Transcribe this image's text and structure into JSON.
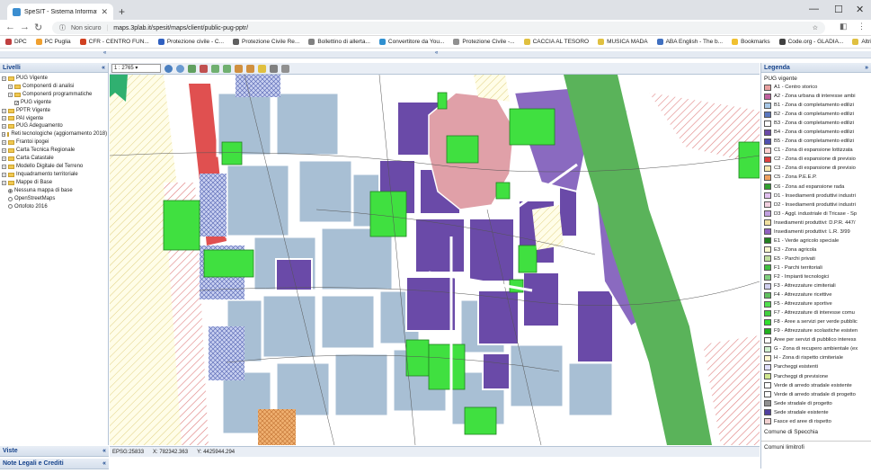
{
  "browser": {
    "tab_title": "SpeSIT - Sistema Informativo Terr",
    "new_tab": "+",
    "not_secure": "Non sicuro",
    "url": "maps.3plab.it/spesit/maps/client/public-pug-pptr/",
    "bookmarks": [
      "DPC",
      "PC Puglia",
      "CFR - CENTRO FUN...",
      "Protezione civile - C...",
      "Protezione Civile Re...",
      "Bollettino di allerta...",
      "Convertitore da You...",
      "Protezione Civile -...",
      "CACCIA AL TESORO",
      "MUSICA MADA",
      "ABA English - The b...",
      "Bookmarks",
      "Code.org - GLADIA...",
      "Altri Preferiti"
    ]
  },
  "left_panel": {
    "title": "Livelli",
    "tree": [
      {
        "label": "PUG Vigente",
        "level": 0,
        "type": "folder"
      },
      {
        "label": "Componenti di analisi",
        "level": 1,
        "type": "folder"
      },
      {
        "label": "Componenti programmatiche",
        "level": 1,
        "type": "folder"
      },
      {
        "label": "PUG vigente",
        "level": 2,
        "type": "check"
      },
      {
        "label": "PPTR Vigente",
        "level": 0,
        "type": "folder"
      },
      {
        "label": "PAI vigente",
        "level": 0,
        "type": "folder"
      },
      {
        "label": "PUG Adeguamento",
        "level": 0,
        "type": "folder"
      },
      {
        "label": "Reti tecnologiche (aggiornamento 2018)",
        "level": 0,
        "type": "folder"
      },
      {
        "label": "Frantoi ipogei",
        "level": 0,
        "type": "folder"
      },
      {
        "label": "Carta Tecnica Regionale",
        "level": 0,
        "type": "folder"
      },
      {
        "label": "Carta Catastale",
        "level": 0,
        "type": "folder"
      },
      {
        "label": "Modello Digitale del Terreno",
        "level": 0,
        "type": "folder"
      },
      {
        "label": "Inquadramento territoriale",
        "level": 0,
        "type": "folder"
      },
      {
        "label": "Mappe di Base",
        "level": 0,
        "type": "folder"
      },
      {
        "label": "Nessuna mappa di base",
        "level": 1,
        "type": "radio",
        "checked": true
      },
      {
        "label": "OpenStreetMaps",
        "level": 1,
        "type": "radio"
      },
      {
        "label": "Ortofoto 2016",
        "level": 1,
        "type": "radio"
      }
    ],
    "viste": "Viste",
    "legali": "Note Legali e Crediti"
  },
  "map_toolbar": {
    "scale": "1 : 2765"
  },
  "status": {
    "epsg": "EPSG:25833",
    "x": "X: 782342.363",
    "y": "Y: 4425944.294"
  },
  "legend": {
    "title": "Legenda",
    "subtitle": "PUG vigente",
    "items": [
      {
        "label": "A1 - Centro storico",
        "color": "#e8a0a0"
      },
      {
        "label": "A2 - Zona urbana di interesse ambi",
        "color": "#c060a0"
      },
      {
        "label": "B1 - Zona di completamento edilizi",
        "color": "#a8c8e8"
      },
      {
        "label": "B2 - Zona di completamento edilizi",
        "color": "#5a78c0"
      },
      {
        "label": "B3 - Zona di completamento edilizi",
        "color": "#ffffff"
      },
      {
        "label": "B4 - Zona di completamento edilizi",
        "color": "#6a4aa8"
      },
      {
        "label": "B5 - Zona di completamento edilizi",
        "color": "#5050b0"
      },
      {
        "label": "C1 - Zona di espansione lottizzata",
        "color": "#ffd0d0"
      },
      {
        "label": "C2 - Zona di espansione di previsio",
        "color": "#e04040"
      },
      {
        "label": "C3 - Zona di espansione di previsio",
        "color": "#f8e8b0"
      },
      {
        "label": "C5 - Zona P.E.E.P.",
        "color": "#f0a060"
      },
      {
        "label": "C6 - Zona ad espansione rada",
        "color": "#30a030"
      },
      {
        "label": "D1 - Insediamenti produttivi industri",
        "color": "#e0c0f0"
      },
      {
        "label": "D2 - Insediamenti produttivi industri",
        "color": "#f0d0e0"
      },
      {
        "label": "D3 - Aggl. industriale di Tricase - Sp",
        "color": "#c0a0e0"
      },
      {
        "label": "Insediamenti produttivi: D.P.R. 447/",
        "color": "#f0e0a0"
      },
      {
        "label": "Insediamenti produttivi: L.R. 3/99",
        "color": "#9060c0"
      },
      {
        "label": "E1 - Verde agricolo speciale",
        "color": "#208020"
      },
      {
        "label": "E3 - Zona agricola",
        "color": "#f8f8d0"
      },
      {
        "label": "E5 - Parchi privati",
        "color": "#c0e0a0"
      },
      {
        "label": "F1 - Parchi territoriali",
        "color": "#40c040"
      },
      {
        "label": "F2 - Impianti tecnologici",
        "color": "#80d080"
      },
      {
        "label": "F3 - Attrezzature cimiteriali",
        "color": "#d0d0f0"
      },
      {
        "label": "F4 - Attrezzature ricettive",
        "color": "#60c060"
      },
      {
        "label": "F5 - Attrezzature sportive",
        "color": "#50e050"
      },
      {
        "label": "F7 - Attrezzature di interesse comu",
        "color": "#40d040"
      },
      {
        "label": "F8 - Aree a servizi per verde pubblic",
        "color": "#30e030"
      },
      {
        "label": "F9 - Attrezzature scolastiche esisten",
        "color": "#20b020"
      },
      {
        "label": "Aree per servizi di pubblico interess",
        "color": "#ffffff"
      },
      {
        "label": "G - Zona di recupero ambientale (ex",
        "color": "#d0f0d0"
      },
      {
        "label": "H - Zona di rispetto cimiteriale",
        "color": "#fff8d0"
      },
      {
        "label": "Parcheggi esistenti",
        "color": "#e0e0ff"
      },
      {
        "label": "Parcheggi di previsione",
        "color": "#d0e890"
      },
      {
        "label": "Verde di arredo stradale esistente",
        "color": "#ffffff"
      },
      {
        "label": "Verde di arredo stradale di progetto",
        "color": "#ffffff"
      },
      {
        "label": "Sede stradale di progetto",
        "color": "#909090"
      },
      {
        "label": "Sede stradale esistente",
        "color": "#5040a0"
      },
      {
        "label": "Fasce ed aree di rispetto",
        "color": "#f0d0d0"
      }
    ],
    "comune": "Comune di Specchia",
    "comuni_limitrofi": "Comuni limitrofi"
  }
}
